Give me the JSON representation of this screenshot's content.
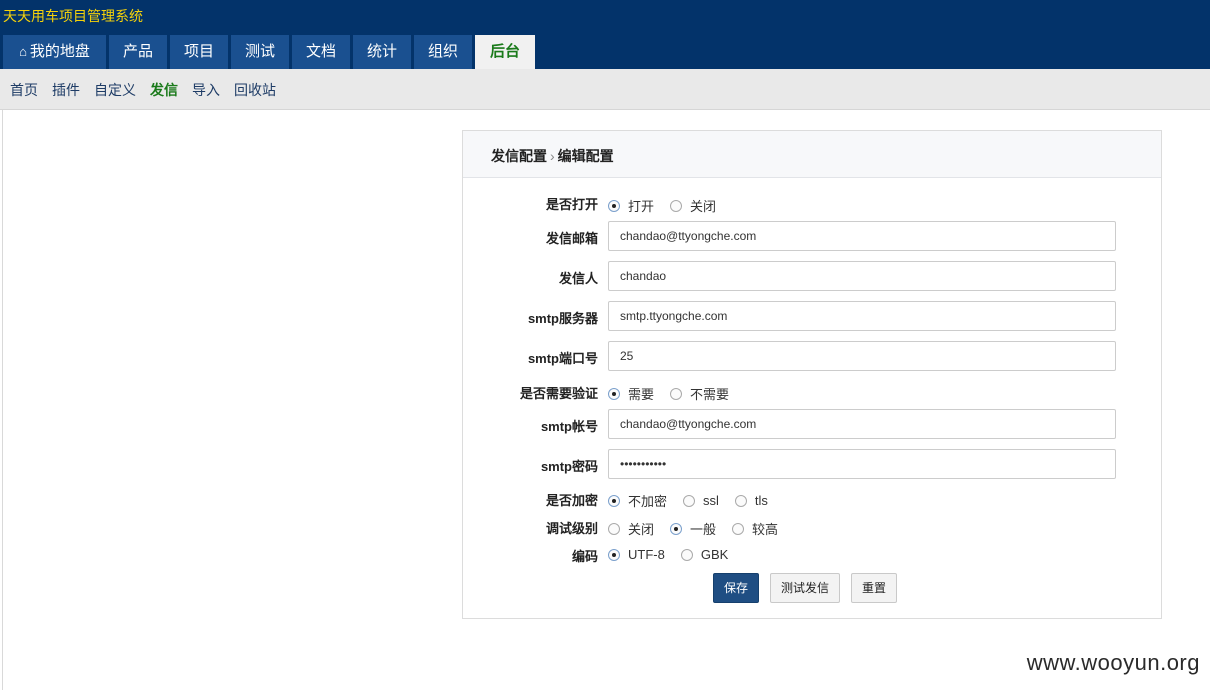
{
  "app": {
    "title": "天天用车项目管理系统"
  },
  "mainnav": {
    "tabs": [
      {
        "label": "我的地盘",
        "icon": "home-icon"
      },
      {
        "label": "产品"
      },
      {
        "label": "项目"
      },
      {
        "label": "测试"
      },
      {
        "label": "文档"
      },
      {
        "label": "统计"
      },
      {
        "label": "组织"
      },
      {
        "label": "后台",
        "active": true
      }
    ]
  },
  "subnav": {
    "items": [
      {
        "label": "首页"
      },
      {
        "label": "插件"
      },
      {
        "label": "自定义"
      },
      {
        "label": "发信",
        "active": true
      },
      {
        "label": "导入"
      },
      {
        "label": "回收站"
      }
    ]
  },
  "panel": {
    "breadcrumb": {
      "parent": "发信配置",
      "sep": "›",
      "current": "编辑配置"
    }
  },
  "form": {
    "turnon": {
      "label": "是否打开",
      "options": [
        "打开",
        "关闭"
      ],
      "selected": "打开"
    },
    "from_address": {
      "label": "发信邮箱",
      "value": "chandao@ttyongche.com"
    },
    "from_name": {
      "label": "发信人",
      "value": "chandao"
    },
    "smtp_host": {
      "label": "smtp服务器",
      "value": "smtp.ttyongche.com"
    },
    "smtp_port": {
      "label": "smtp端口号",
      "value": "25"
    },
    "auth": {
      "label": "是否需要验证",
      "options": [
        "需要",
        "不需要"
      ],
      "selected": "需要"
    },
    "smtp_user": {
      "label": "smtp帐号",
      "value": "chandao@ttyongche.com"
    },
    "smtp_pass": {
      "label": "smtp密码",
      "value": "•••••••••••"
    },
    "secure": {
      "label": "是否加密",
      "options": [
        "不加密",
        "ssl",
        "tls"
      ],
      "selected": "不加密"
    },
    "debug": {
      "label": "调试级别",
      "options": [
        "关闭",
        "一般",
        "较高"
      ],
      "selected": "一般"
    },
    "charset": {
      "label": "编码",
      "options": [
        "UTF-8",
        "GBK"
      ],
      "selected": "UTF-8"
    }
  },
  "actions": {
    "save": "保存",
    "test": "测试发信",
    "reset": "重置"
  },
  "watermark": "www.wooyun.org",
  "colors": {
    "topbar": "#03336a",
    "tab": "#1a5090",
    "active_text": "#1a7a1a",
    "title": "#f5d20a",
    "primary": "#1f4e83"
  }
}
